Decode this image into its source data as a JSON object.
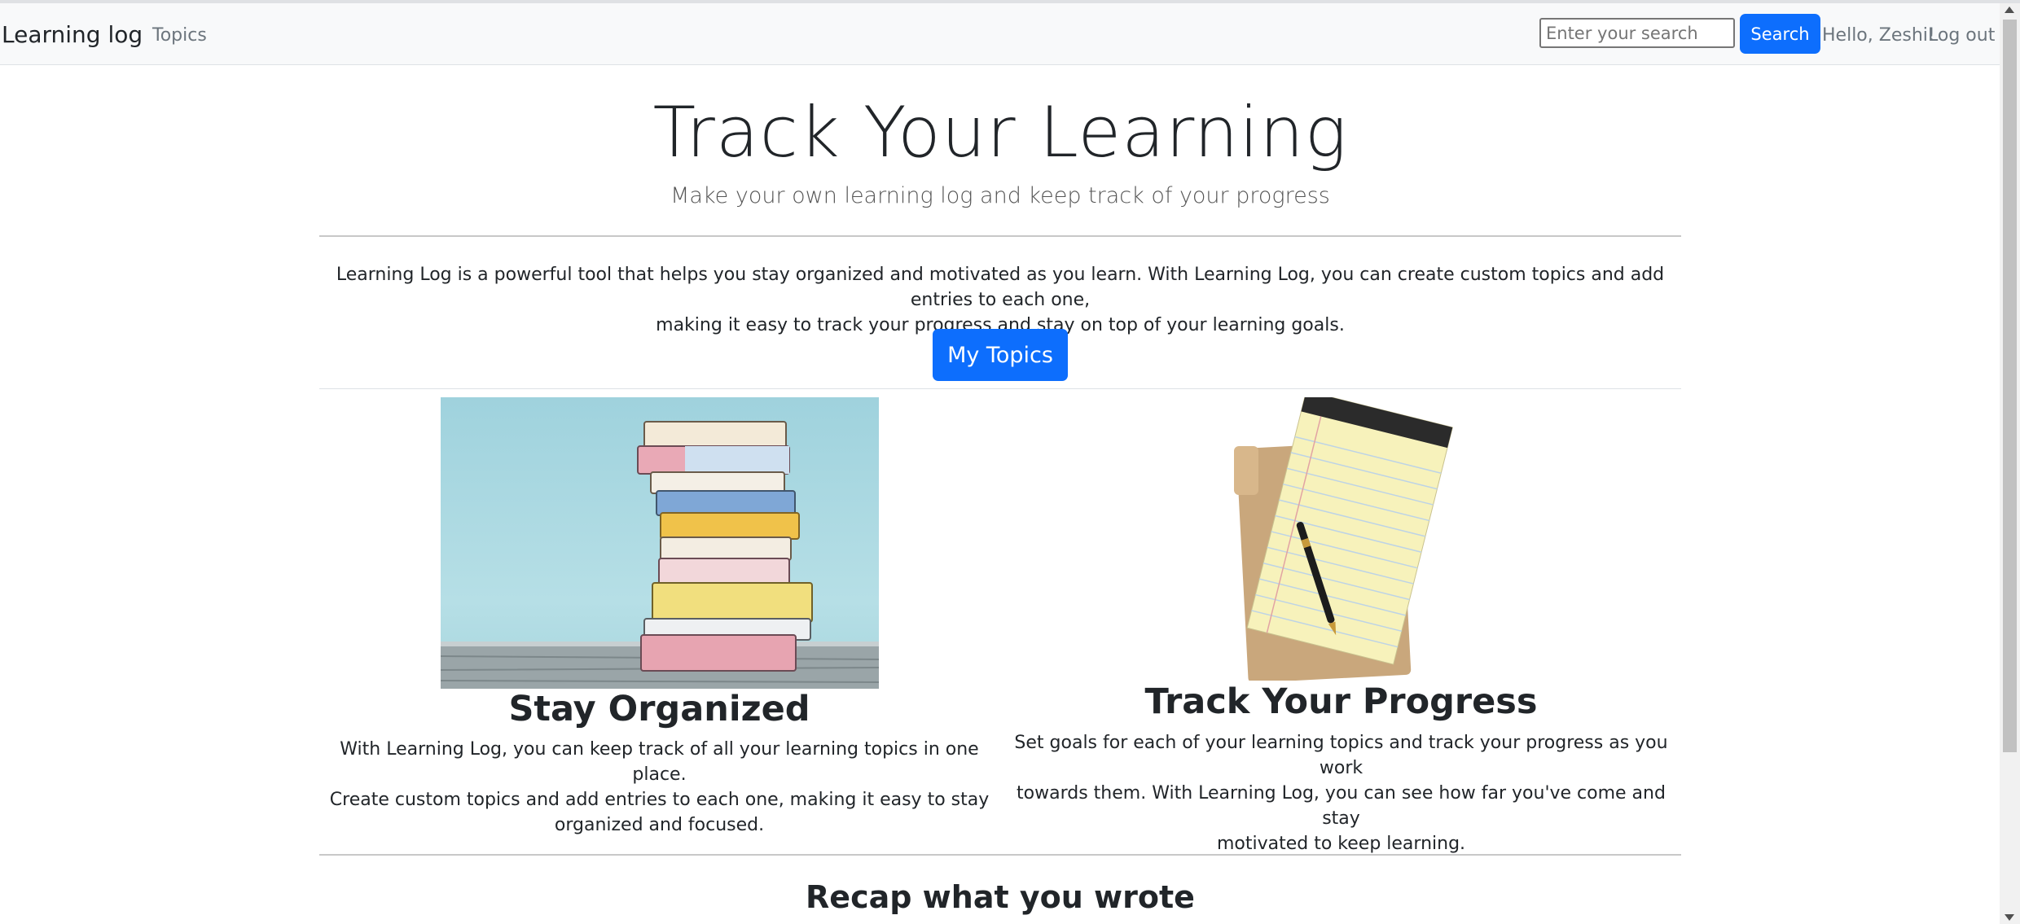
{
  "navbar": {
    "brand": "Learning log",
    "topics_link": "Topics",
    "search_placeholder": "Enter your search",
    "search_button": "Search",
    "greeting": "Hello, Zeshi!",
    "logout": "Log out"
  },
  "hero": {
    "title": "Track Your Learning",
    "subtitle": "Make your own learning log and keep track of your progress"
  },
  "intro": {
    "line1": "Learning Log is a powerful tool that helps you stay organized and motivated as you learn. With Learning Log, you can create custom topics and add entries to each one,",
    "line2": "making it easy to track your progress and stay on top of your learning goals.",
    "button": "My Topics"
  },
  "features": [
    {
      "title": "Stay Organized",
      "line1": "With Learning Log, you can keep track of all your learning topics in one place.",
      "line2": "Create custom topics and add entries to each one, making it easy to stay",
      "line3": "organized and focused."
    },
    {
      "title": "Track Your Progress",
      "line1": "Set goals for each of your learning topics and track your progress as you work",
      "line2": "towards them. With Learning Log, you can see how far you've come and stay",
      "line3": "motivated to keep learning."
    }
  ],
  "recap": {
    "title": "Recap what you wrote"
  },
  "colors": {
    "primary": "#0d6efd",
    "navbar_bg": "#f8f9fa",
    "muted": "#6c757d"
  }
}
